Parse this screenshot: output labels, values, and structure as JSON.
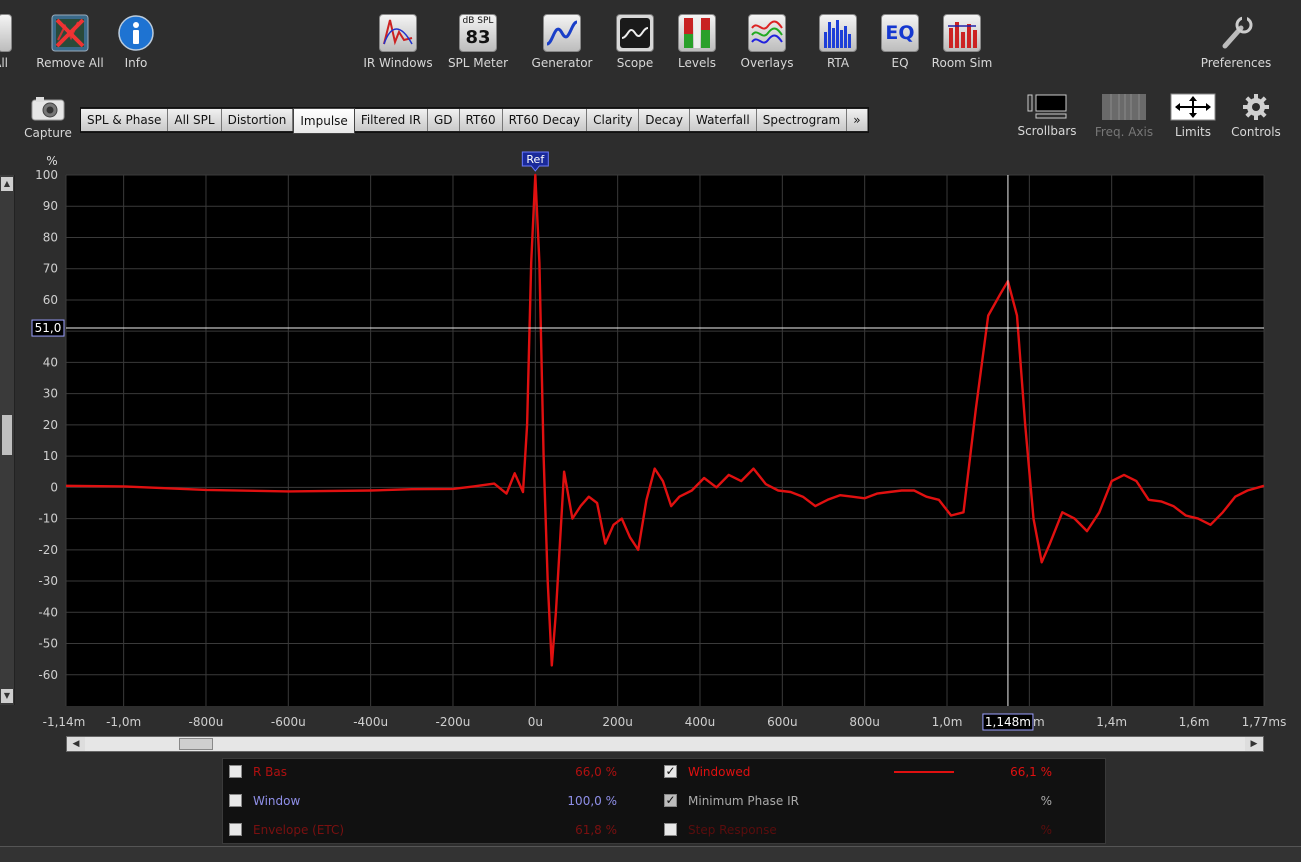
{
  "toolbar": {
    "left_partial": "All",
    "remove_all": "Remove All",
    "info": "Info",
    "ir_windows": "IR Windows",
    "spl_meter": "SPL Meter",
    "spl_meter_unit": "dB SPL",
    "spl_meter_value": "83",
    "generator": "Generator",
    "scope": "Scope",
    "levels": "Levels",
    "overlays": "Overlays",
    "rta": "RTA",
    "eq": "EQ",
    "eq_icon_text": "EQ",
    "room_sim": "Room Sim",
    "preferences": "Preferences"
  },
  "capture": "Capture",
  "tabs": [
    "SPL & Phase",
    "All SPL",
    "Distortion",
    "Impulse",
    "Filtered IR",
    "GD",
    "RT60",
    "RT60 Decay",
    "Clarity",
    "Decay",
    "Waterfall",
    "Spectrogram",
    "»"
  ],
  "active_tab": "Impulse",
  "right_controls": {
    "scrollbars": "Scrollbars",
    "freq_axis": "Freq. Axis",
    "limits": "Limits",
    "controls": "Controls"
  },
  "chart_data": {
    "type": "line",
    "ylabel": "%",
    "ylim": [
      -70,
      100
    ],
    "y_ticks": [
      100,
      90,
      80,
      70,
      60,
      50,
      40,
      30,
      20,
      10,
      0,
      -10,
      -20,
      -30,
      -40,
      -50,
      -60
    ],
    "xlim": [
      -1.14,
      1.77
    ],
    "x_tick_labels": [
      "-1,14m",
      "-1,0m",
      "-800u",
      "-600u",
      "-400u",
      "-200u",
      "0u",
      "200u",
      "400u",
      "600u",
      "800u",
      "1,0m",
      "1,2m",
      "1,4m",
      "1,6m",
      "1,77ms"
    ],
    "x_tick_values": [
      -1.14,
      -1.0,
      -0.8,
      -0.6,
      -0.4,
      -0.2,
      0,
      0.2,
      0.4,
      0.6,
      0.8,
      1.0,
      1.2,
      1.4,
      1.6,
      1.77
    ],
    "ref_marker": "Ref",
    "cursor_y_label": "51,0",
    "cursor_y": 51,
    "cursor_x_label": "1,148m",
    "cursor_x": 1.148,
    "series": [
      {
        "name": "Windowed",
        "color": "#e01010",
        "x": [
          -1.14,
          -1.0,
          -0.8,
          -0.6,
          -0.4,
          -0.3,
          -0.2,
          -0.15,
          -0.1,
          -0.07,
          -0.05,
          -0.03,
          -0.02,
          -0.01,
          0.0,
          0.01,
          0.02,
          0.03,
          0.04,
          0.05,
          0.07,
          0.09,
          0.11,
          0.13,
          0.15,
          0.17,
          0.19,
          0.21,
          0.23,
          0.25,
          0.27,
          0.29,
          0.31,
          0.33,
          0.35,
          0.38,
          0.41,
          0.44,
          0.47,
          0.5,
          0.53,
          0.56,
          0.59,
          0.62,
          0.65,
          0.68,
          0.71,
          0.74,
          0.77,
          0.8,
          0.83,
          0.86,
          0.89,
          0.92,
          0.95,
          0.98,
          1.01,
          1.04,
          1.07,
          1.1,
          1.13,
          1.148,
          1.17,
          1.19,
          1.21,
          1.23,
          1.25,
          1.28,
          1.31,
          1.34,
          1.37,
          1.4,
          1.43,
          1.46,
          1.49,
          1.52,
          1.55,
          1.58,
          1.61,
          1.64,
          1.67,
          1.7,
          1.73,
          1.77
        ],
        "y": [
          0.5,
          0.3,
          -0.8,
          -1.3,
          -1.0,
          -0.6,
          -0.5,
          0.3,
          1.2,
          -2.0,
          4.5,
          -1.5,
          20,
          72,
          100,
          72,
          10,
          -30,
          -57,
          -40,
          5,
          -10,
          -6,
          -3,
          -5,
          -18,
          -12,
          -10,
          -16,
          -20,
          -4,
          6,
          2,
          -6,
          -3,
          -1,
          3,
          0,
          4,
          2,
          6,
          1,
          -1,
          -1.5,
          -3,
          -6,
          -4,
          -2.5,
          -3,
          -3.5,
          -2,
          -1.5,
          -1,
          -1,
          -3,
          -4,
          -9,
          -8,
          25,
          55,
          62,
          66,
          55,
          20,
          -10,
          -24,
          -18,
          -8,
          -10,
          -14,
          -8,
          2,
          4,
          2,
          -4,
          -4.5,
          -6,
          -9,
          -10,
          -12,
          -8,
          -3,
          -1,
          0.5
        ]
      }
    ]
  },
  "legend": {
    "r_bas": {
      "label": "R Bas",
      "value": "66,0 %",
      "color": "#b01010"
    },
    "window": {
      "label": "Window",
      "value": "100,0 %",
      "color": "#8f8fe8"
    },
    "envelope": {
      "label": "Envelope (ETC)",
      "value": "61,8 %",
      "color": "#7a1010"
    },
    "windowed": {
      "label": "Windowed",
      "value": "66,1 %",
      "color": "#e01010",
      "check": "✓"
    },
    "min_phase": {
      "label": "Minimum Phase IR",
      "value": "%",
      "color": "#aaaaaa",
      "check": "✓"
    },
    "step_response": {
      "label": "Step Response",
      "value": "%",
      "color": "#5a0d0d"
    }
  }
}
